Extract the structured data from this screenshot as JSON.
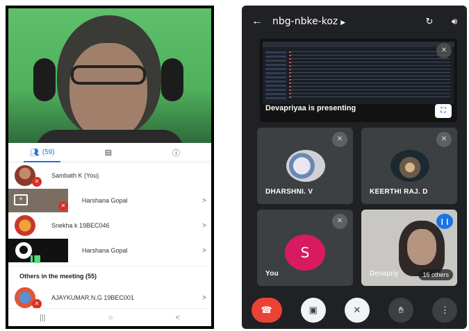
{
  "left": {
    "tabs": [
      {
        "icon": "people-icon",
        "label": "(59)"
      },
      {
        "icon": "chat-icon",
        "label": ""
      },
      {
        "icon": "info-icon",
        "label": ""
      }
    ],
    "participants": [
      {
        "name": "Sambath K (You)",
        "muted": true
      },
      {
        "name": "Harshana Gopal",
        "muted": true,
        "presenting": true
      },
      {
        "name": "Snekha k 19BEC046",
        "muted": false
      },
      {
        "name": "Harshana Gopal",
        "speaking": true
      }
    ],
    "others_heading": "Others in the meeting (55)",
    "others": [
      {
        "name": "AJAYKUMAR.N.G 19BEC001",
        "muted": true
      }
    ],
    "chevron": ">",
    "navbar": {
      "recents": "|||",
      "home": "○",
      "back": "<"
    }
  },
  "right": {
    "meeting_code": "nbg-nbke-koz",
    "presentation_label": "Devapriyaa is presenting",
    "tiles": [
      {
        "name": "DHARSHNI. V"
      },
      {
        "name": "KEERTHI RAJ. D"
      },
      {
        "name": "You",
        "initial": "S",
        "avatar_color": "#d81b60"
      },
      {
        "name": "Devapriy",
        "others_label": "16 others"
      }
    ],
    "colors": {
      "background": "#202124",
      "tile": "#3c4043",
      "end_call": "#ea4335",
      "accent": "#1a73e8"
    }
  }
}
